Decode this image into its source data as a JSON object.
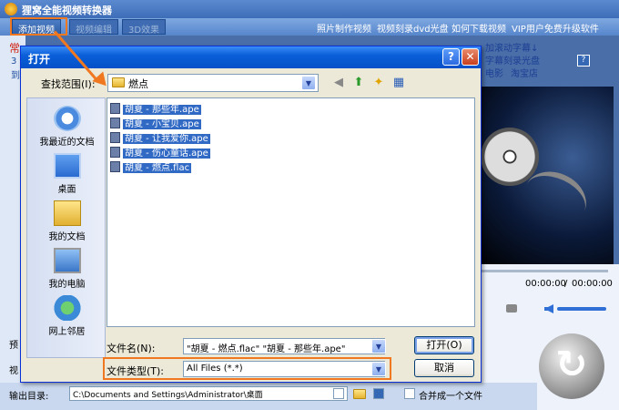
{
  "app": {
    "title": "狸窝全能视频转换器",
    "toolbar": {
      "add_video": "添加视频",
      "edit_video": "视频编辑",
      "effect_3d": "3D效果"
    },
    "top_links": [
      "照片制作视频",
      "视频刻录dvd光盘",
      "如何下载视频",
      "VIP用户免费升级软件"
    ],
    "side_fragments": [
      "常",
      "3",
      "到"
    ],
    "promo_links": [
      "加滚动字幕↓",
      "字幕刻录光盘",
      "电影",
      "淘宝店"
    ],
    "help_label": "?",
    "side_labels": [
      "预",
      "视"
    ],
    "preview": {
      "time_current": "00:00:00",
      "time_total": "00:00:00",
      "time_separator": "/"
    },
    "bottom": {
      "output_label": "输出目录:",
      "output_path": "C:\\Documents and Settings\\Administrator\\桌面",
      "merge_label": "合并成一个文件"
    }
  },
  "dialog": {
    "title": "打开",
    "help_button": "?",
    "close_button": "✕",
    "lookin_label": "查找范围(I):",
    "lookin_value": "燃点",
    "places": [
      {
        "label": "我最近的文档"
      },
      {
        "label": "桌面"
      },
      {
        "label": "我的文档"
      },
      {
        "label": "我的电脑"
      },
      {
        "label": "网上邻居"
      }
    ],
    "files": [
      "胡夏 - 那些年.ape",
      "胡夏 - 小宝贝.ape",
      "胡夏 - 让我爱你.ape",
      "胡夏 - 伤心童话.ape",
      "胡夏 - 燃点.flac"
    ],
    "filename_label": "文件名(N):",
    "filename_value": "\"胡夏 - 燃点.flac\" \"胡夏 - 那些年.ape\"",
    "filetype_label": "文件类型(T):",
    "filetype_value": "All Files (*.*)",
    "open_button": "打开(O)",
    "cancel_button": "取消"
  },
  "colors": {
    "highlight_orange": "#f07820",
    "selection_blue": "#316ac5",
    "titlebar_blue": "#0a5fd8"
  }
}
